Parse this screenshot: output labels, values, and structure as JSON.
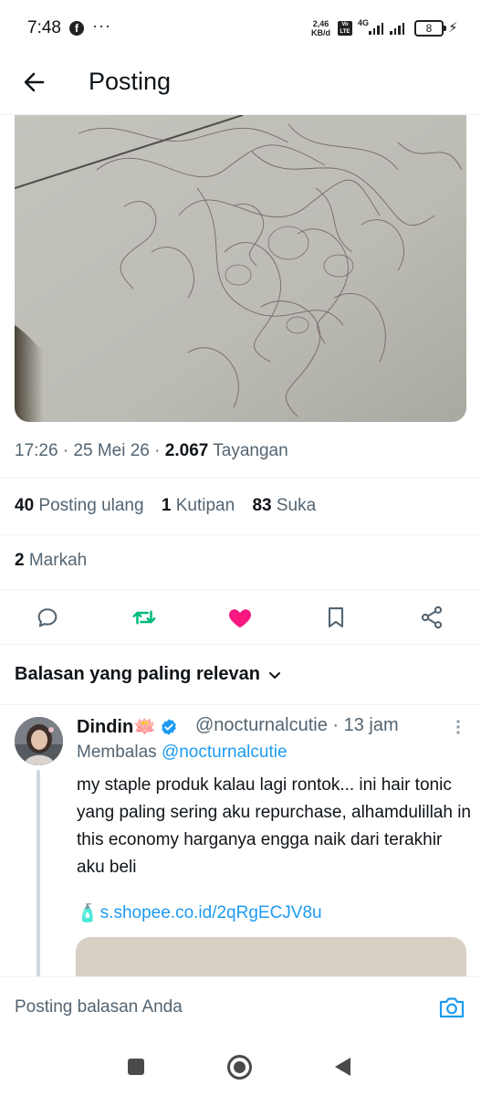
{
  "status_bar": {
    "time": "7:48",
    "fb_icon": "f",
    "more_dots": "···",
    "speed_value": "2,46",
    "speed_unit": "KB/d",
    "volte": "Vo LTE",
    "network": "4G",
    "battery": "8"
  },
  "header": {
    "title": "Posting",
    "back_icon": "arrow-left-icon"
  },
  "post": {
    "time": "17:26",
    "date": "25 Mei 26",
    "views_count": "2.067",
    "views_label": "Tayangan",
    "reposts_count": "40",
    "reposts_label": "Posting ulang",
    "quotes_count": "1",
    "quotes_label": "Kutipan",
    "likes_count": "83",
    "likes_label": "Suka",
    "bookmarks_count": "2",
    "bookmarks_label": "Markah"
  },
  "actions": {
    "reply_icon": "reply-icon",
    "repost_icon": "repost-icon",
    "like_icon": "heart-icon",
    "bookmark_icon": "bookmark-icon",
    "share_icon": "share-icon",
    "repost_color": "#00ba7c",
    "like_color": "#f91880"
  },
  "replies": {
    "sort_label": "Balasan yang paling relevan",
    "items": [
      {
        "name": "Dindin🪷",
        "handle": "@nocturnalcutie",
        "separator": "·",
        "time": "13 jam",
        "replying_prefix": "Membalas",
        "replying_to": "@nocturnalcutie",
        "text": "my staple produk kalau lagi rontok... ini hair tonic yang paling sering aku repurchase, alhamdulillah in this economy harganya engga naik dari terakhir aku beli",
        "link_emoji": "🧴",
        "link": "s.shopee.co.id/2qRgECJV8u"
      }
    ]
  },
  "composer": {
    "placeholder": "Posting balasan Anda"
  },
  "colors": {
    "accent": "#1d9bf0",
    "text": "#0f1419",
    "secondary": "#536471"
  }
}
